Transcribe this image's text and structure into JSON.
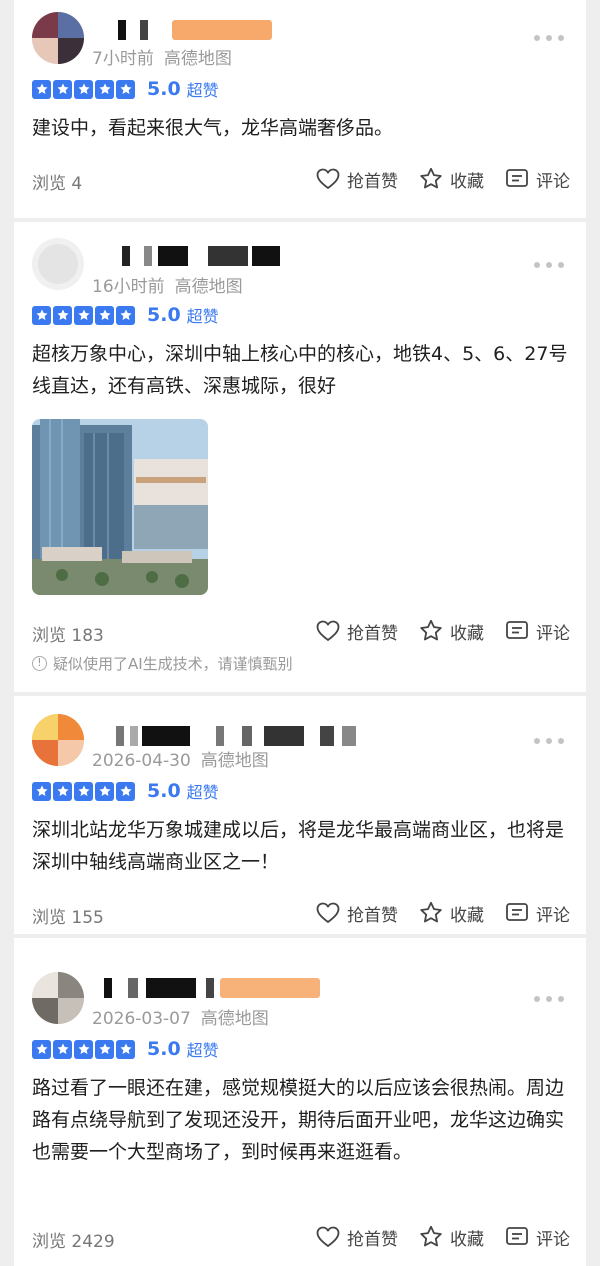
{
  "colors": {
    "accent": "#3a79f0",
    "muted": "#9a9a9a"
  },
  "reviews": [
    {
      "time": "7小时前",
      "source": "高德地图",
      "score": "5.0",
      "level": "超赞",
      "text": "建设中，看起来很大气，龙华高端奢侈品。",
      "views": "浏览 4",
      "like": "抢首赞",
      "fav": "收藏",
      "comment": "评论"
    },
    {
      "time": "16小时前",
      "source": "高德地图",
      "score": "5.0",
      "level": "超赞",
      "text": "超核万象中心，深圳中轴上核心中的核心，地铁4、5、6、27号线直达，还有高铁、深惠城际，很好",
      "views": "浏览 183",
      "like": "抢首赞",
      "fav": "收藏",
      "comment": "评论",
      "ai_note": "疑似使用了AI生成技术，请谨慎甄别"
    },
    {
      "time": "2026-04-30",
      "source": "高德地图",
      "score": "5.0",
      "level": "超赞",
      "text": "深圳北站龙华万象城建成以后，将是龙华最高端商业区，也将是深圳中轴线高端商业区之一！",
      "views": "浏览 155",
      "like": "抢首赞",
      "fav": "收藏",
      "comment": "评论"
    },
    {
      "time": "2026-03-07",
      "source": "高德地图",
      "score": "5.0",
      "level": "超赞",
      "text": "路过看了一眼还在建，感觉规模挺大的以后应该会很热闹。周边路有点绕导航到了发现还没开，期待后面开业吧，龙华这边确实也需要一个大型商场了，到时候再来逛逛看。",
      "views": "浏览 2429",
      "like": "抢首赞",
      "fav": "收藏",
      "comment": "评论"
    }
  ]
}
